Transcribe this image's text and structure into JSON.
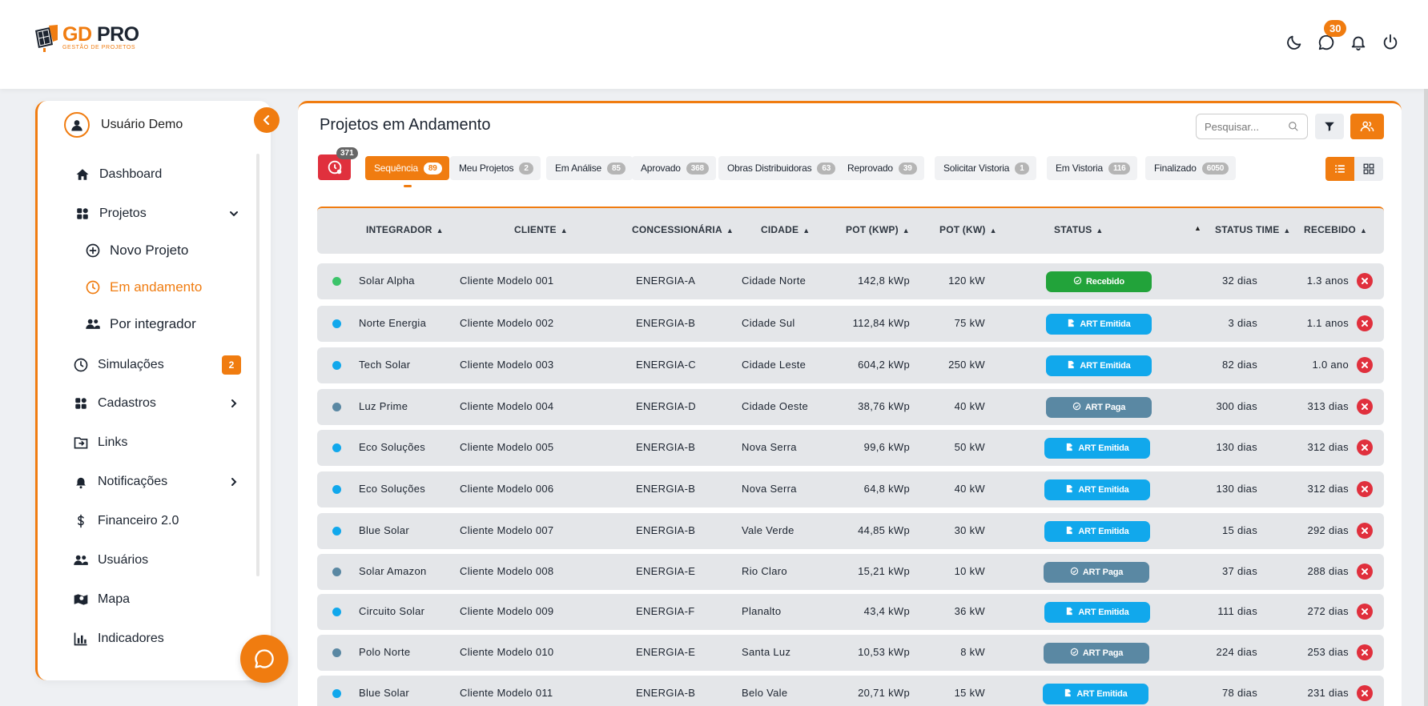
{
  "brand": {
    "title_a": "GD",
    "title_b": " PRO",
    "subtitle": "GESTÃO DE PROJETOS"
  },
  "header": {
    "message_badge": "30"
  },
  "user": {
    "name": "Usuário Demo"
  },
  "nav": {
    "dashboard": "Dashboard",
    "projetos": "Projetos",
    "novo_projeto": "Novo Projeto",
    "em_andamento": "Em andamento",
    "por_integrador": "Por integrador",
    "simulacoes": "Simulações",
    "simulacoes_badge": "2",
    "cadastros": "Cadastros",
    "links": "Links",
    "notificacoes": "Notificações",
    "financeiro": "Financeiro 2.0",
    "usuarios": "Usuários",
    "mapa": "Mapa",
    "indicadores": "Indicadores"
  },
  "page": {
    "title": "Projetos em Andamento",
    "search_placeholder": "Pesquisar..."
  },
  "timer_badge": "371",
  "tabs": [
    {
      "label": "Sequência",
      "count": "89"
    },
    {
      "label": "Meu Projetos",
      "count": "2"
    },
    {
      "label": "Em Análise",
      "count": "85"
    },
    {
      "label": "Aprovado",
      "count": "368"
    },
    {
      "label": "Obras Distribuidoras",
      "count": "63"
    },
    {
      "label": "Reprovado",
      "count": "39"
    },
    {
      "label": "Solicitar Vistoria",
      "count": "1"
    },
    {
      "label": "Em Vistoria",
      "count": "116"
    },
    {
      "label": "Finalizado",
      "count": "6050"
    }
  ],
  "columns": {
    "integrador": "INTEGRADOR",
    "cliente": "CLIENTE",
    "concessionaria": "CONCESSIONÁRIA",
    "cidade": "CIDADE",
    "pot_kwp": "POT (KWP)",
    "pot_kw": "POT (KW)",
    "status": "STATUS",
    "status_time": "STATUS TIME",
    "recebido": "RECEBIDO"
  },
  "status_colors": {
    "Recebido": "#22a33a",
    "ART Emitida": "#11a8ec",
    "ART Paga": "#5a88a3"
  },
  "rows": [
    {
      "integrador": "Solar Alpha",
      "cliente": "Cliente Modelo 001",
      "concessionaria": "ENERGIA-A",
      "cidade": "Cidade Norte",
      "pot_kwp": "142,8 kWp",
      "pot_kw": "120 kW",
      "status": "Recebido",
      "status_time": "32 dias",
      "recebido": "1.3 anos",
      "dot": "#3cc46a"
    },
    {
      "integrador": "Norte Energia",
      "cliente": "Cliente Modelo 002",
      "concessionaria": "ENERGIA-B",
      "cidade": "Cidade Sul",
      "pot_kwp": "112,84 kWp",
      "pot_kw": "75 kW",
      "status": "ART Emitida",
      "status_time": "3 dias",
      "recebido": "1.1 anos",
      "dot": "#11a8ec"
    },
    {
      "integrador": "Tech Solar",
      "cliente": "Cliente Modelo 003",
      "concessionaria": "ENERGIA-C",
      "cidade": "Cidade Leste",
      "pot_kwp": "604,2 kWp",
      "pot_kw": "250 kW",
      "status": "ART Emitida",
      "status_time": "82 dias",
      "recebido": "1.0 ano",
      "dot": "#11a8ec"
    },
    {
      "integrador": "Luz Prime",
      "cliente": "Cliente Modelo 004",
      "concessionaria": "ENERGIA-D",
      "cidade": "Cidade Oeste",
      "pot_kwp": "38,76 kWp",
      "pot_kw": "40 kW",
      "status": "ART Paga",
      "status_time": "300 dias",
      "recebido": "313 dias",
      "dot": "#5a88a3"
    },
    {
      "integrador": "Eco Soluções",
      "cliente": "Cliente Modelo 005",
      "concessionaria": "ENERGIA-B",
      "cidade": "Nova Serra",
      "pot_kwp": "99,6 kWp",
      "pot_kw": "50 kW",
      "status": "ART Emitida",
      "status_time": "130 dias",
      "recebido": "312 dias",
      "dot": "#11a8ec"
    },
    {
      "integrador": "Eco Soluções",
      "cliente": "Cliente Modelo 006",
      "concessionaria": "ENERGIA-B",
      "cidade": "Nova Serra",
      "pot_kwp": "64,8 kWp",
      "pot_kw": "40 kW",
      "status": "ART Emitida",
      "status_time": "130 dias",
      "recebido": "312 dias",
      "dot": "#11a8ec"
    },
    {
      "integrador": "Blue Solar",
      "cliente": "Cliente Modelo 007",
      "concessionaria": "ENERGIA-B",
      "cidade": "Vale Verde",
      "pot_kwp": "44,85 kWp",
      "pot_kw": "30 kW",
      "status": "ART Emitida",
      "status_time": "15 dias",
      "recebido": "292 dias",
      "dot": "#11a8ec"
    },
    {
      "integrador": "Solar Amazon",
      "cliente": "Cliente Modelo 008",
      "concessionaria": "ENERGIA-E",
      "cidade": "Rio Claro",
      "pot_kwp": "15,21 kWp",
      "pot_kw": "10 kW",
      "status": "ART Paga",
      "status_time": "37 dias",
      "recebido": "288 dias",
      "dot": "#5a88a3"
    },
    {
      "integrador": "Circuito Solar",
      "cliente": "Cliente Modelo 009",
      "concessionaria": "ENERGIA-F",
      "cidade": "Planalto",
      "pot_kwp": "43,4 kWp",
      "pot_kw": "36 kW",
      "status": "ART Emitida",
      "status_time": "111 dias",
      "recebido": "272 dias",
      "dot": "#11a8ec"
    },
    {
      "integrador": "Polo Norte",
      "cliente": "Cliente Modelo 010",
      "concessionaria": "ENERGIA-E",
      "cidade": "Santa Luz",
      "pot_kwp": "10,53 kWp",
      "pot_kw": "8 kW",
      "status": "ART Paga",
      "status_time": "224 dias",
      "recebido": "253 dias",
      "dot": "#5a88a3"
    },
    {
      "integrador": "Blue Solar",
      "cliente": "Cliente Modelo 011",
      "concessionaria": "ENERGIA-B",
      "cidade": "Belo Vale",
      "pot_kwp": "20,71 kWp",
      "pot_kw": "15 kW",
      "status": "ART Emitida",
      "status_time": "78 dias",
      "recebido": "231 dias",
      "dot": "#11a8ec"
    }
  ]
}
